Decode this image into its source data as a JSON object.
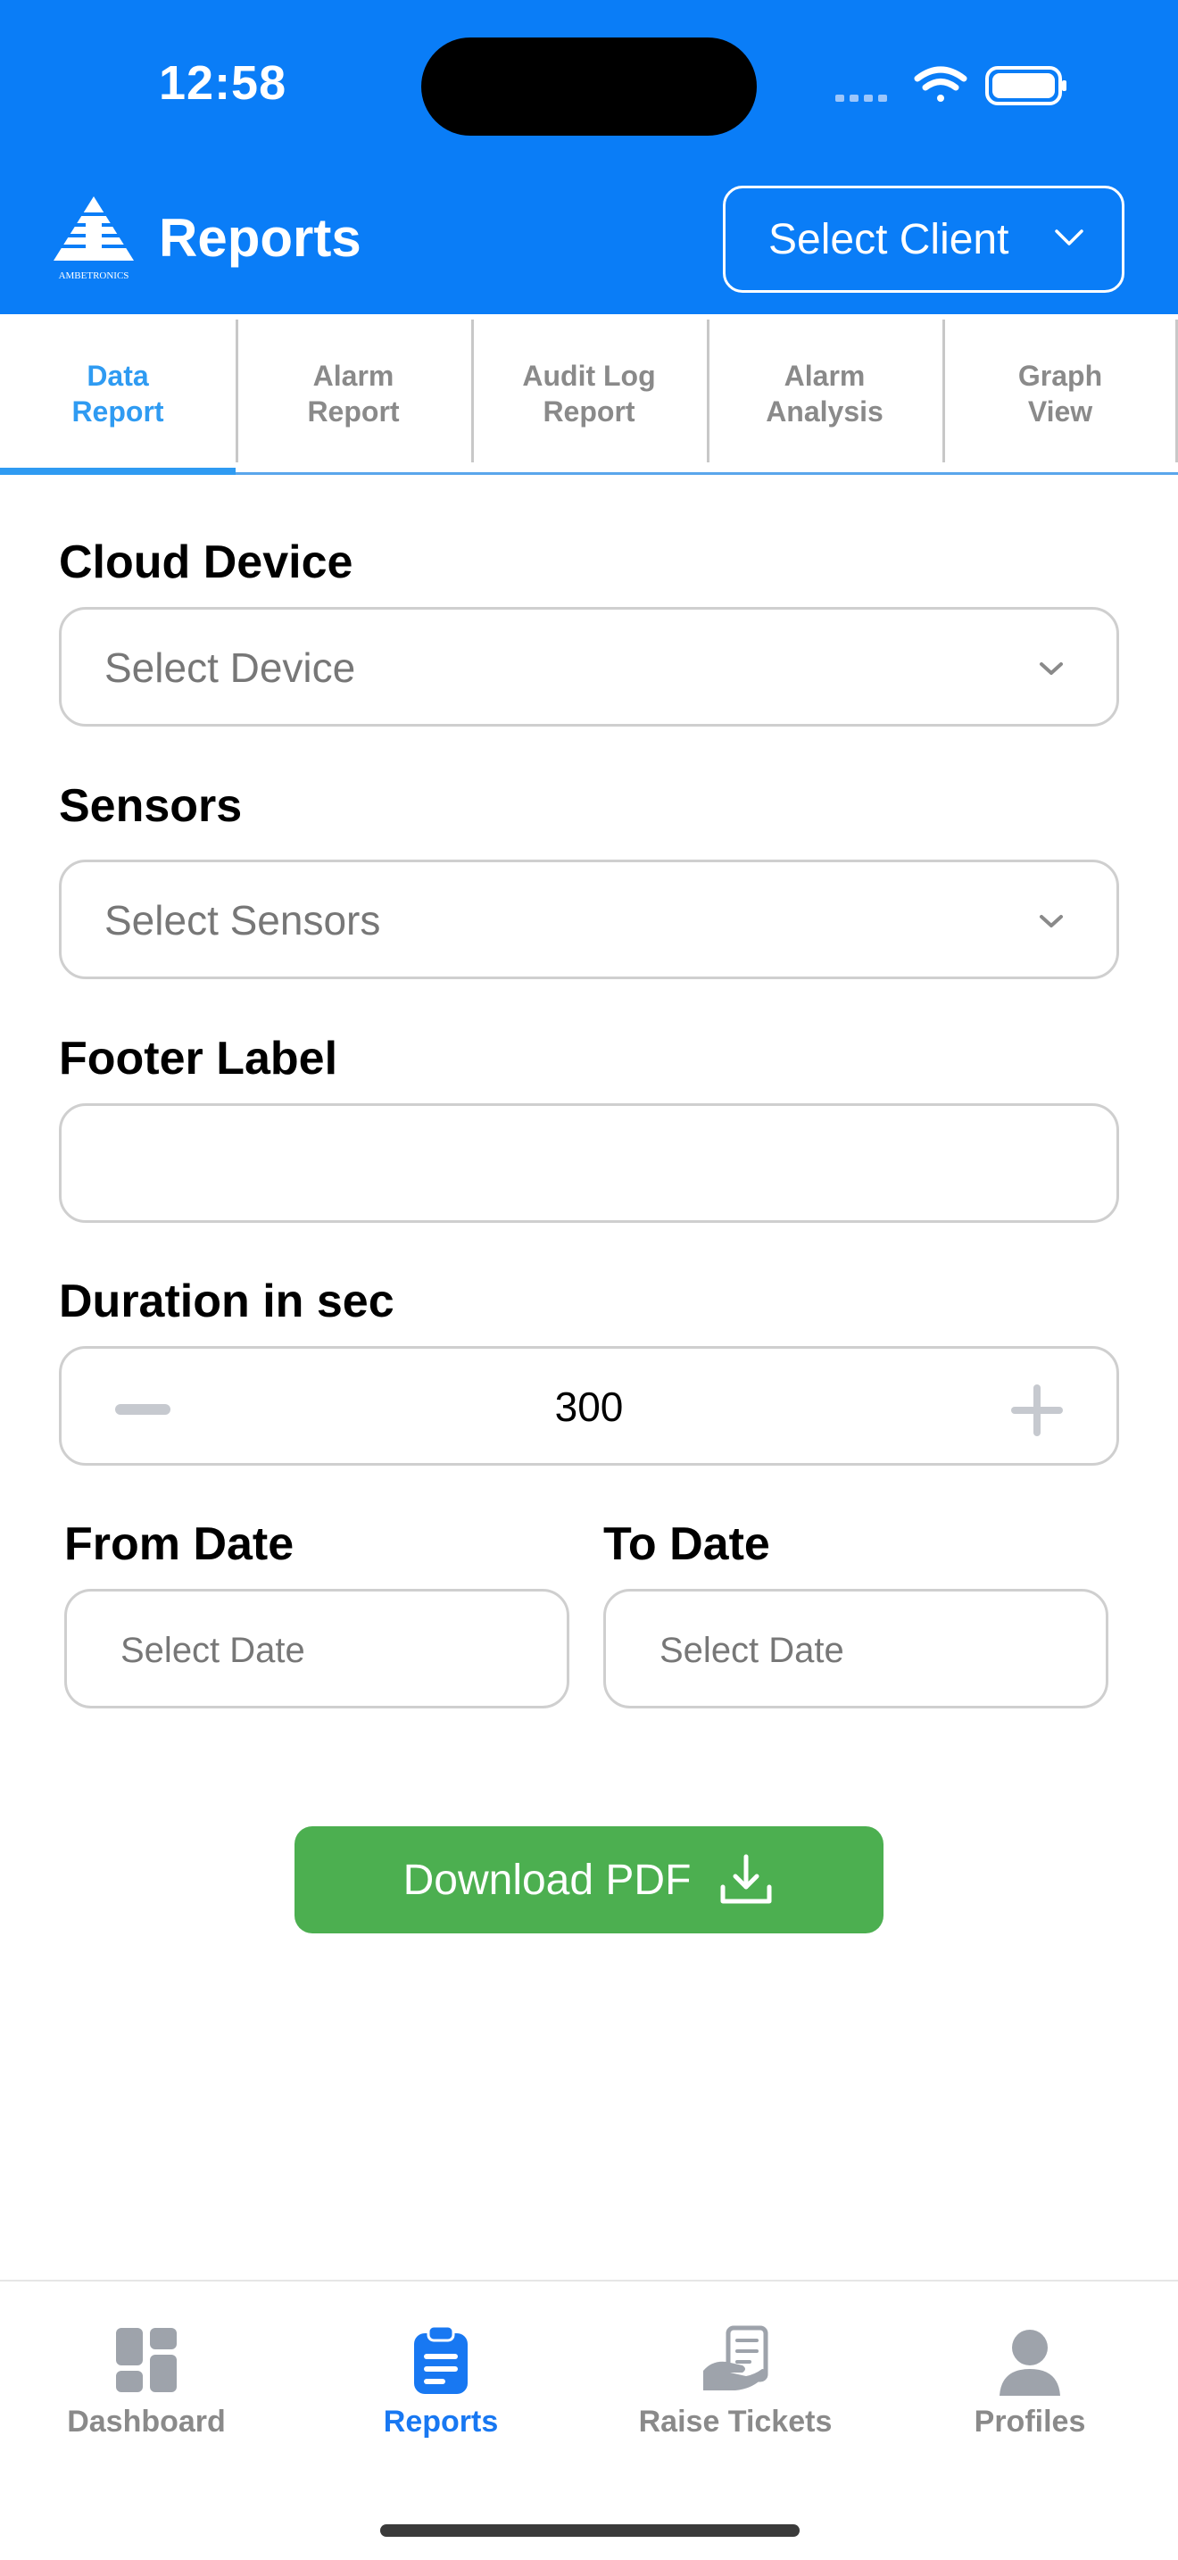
{
  "status_bar": {
    "time": "12:58"
  },
  "header": {
    "logo_text": "AMBETRONICS",
    "title": "Reports",
    "client_select_label": "Select Client"
  },
  "tabs": [
    {
      "label_line1": "Data",
      "label_line2": "Report",
      "active": true
    },
    {
      "label_line1": "Alarm",
      "label_line2": "Report",
      "active": false
    },
    {
      "label_line1": "Audit Log",
      "label_line2": "Report",
      "active": false
    },
    {
      "label_line1": "Alarm",
      "label_line2": "Analysis",
      "active": false
    },
    {
      "label_line1": "Graph",
      "label_line2": "View",
      "active": false
    }
  ],
  "form": {
    "cloud_device": {
      "label": "Cloud Device",
      "placeholder": "Select Device"
    },
    "sensors": {
      "label": "Sensors",
      "placeholder": "Select Sensors"
    },
    "footer_label": {
      "label": "Footer Label",
      "value": ""
    },
    "duration": {
      "label": "Duration in sec",
      "value": "300"
    },
    "from_date": {
      "label": "From Date",
      "placeholder": "Select Date"
    },
    "to_date": {
      "label": "To Date",
      "placeholder": "Select Date"
    },
    "download_label": "Download PDF"
  },
  "bottom_nav": [
    {
      "label": "Dashboard",
      "icon": "dashboard-icon",
      "active": false
    },
    {
      "label": "Reports",
      "icon": "clipboard-icon",
      "active": true
    },
    {
      "label": "Raise Tickets",
      "icon": "ticket-icon",
      "active": false
    },
    {
      "label": "Profiles",
      "icon": "profile-icon",
      "active": false
    }
  ],
  "colors": {
    "header_bg": "#0a7df7",
    "active_tab": "#2f9bf2",
    "download_bg": "#4caf50",
    "nav_active": "#1878f2",
    "nav_inactive": "#8a8a8a"
  }
}
